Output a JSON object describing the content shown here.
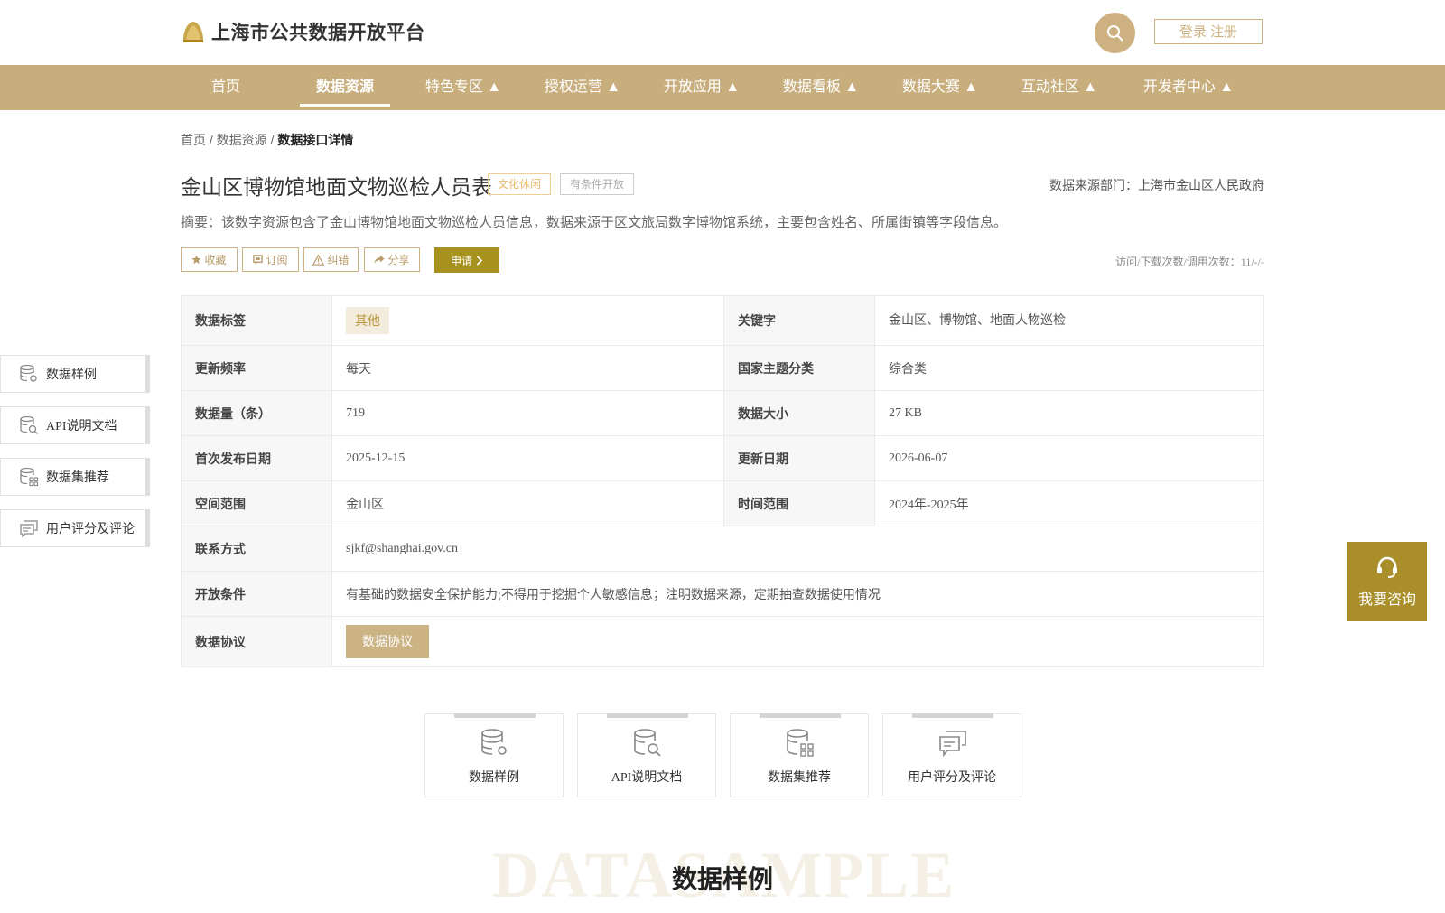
{
  "header": {
    "site_title": "上海市公共数据开放平台",
    "login_label": "登录 注册"
  },
  "nav": {
    "items": [
      {
        "label": "首页"
      },
      {
        "label": "数据资源"
      },
      {
        "label": "特色专区 ▲"
      },
      {
        "label": "授权运营 ▲"
      },
      {
        "label": "开放应用 ▲"
      },
      {
        "label": "数据看板 ▲"
      },
      {
        "label": "数据大赛 ▲"
      },
      {
        "label": "互动社区 ▲"
      },
      {
        "label": "开发者中心 ▲"
      }
    ]
  },
  "breadcrumb": {
    "home": "首页",
    "sep1": " / ",
    "resources": "数据资源",
    "sep2": " / ",
    "current": "数据接口详情"
  },
  "dataset": {
    "title": "金山区博物馆地面文物巡检人员表",
    "tag_category": "文化休闲",
    "tag_condition": "有条件开放",
    "source_dept": "数据来源部门：上海市金山区人民政府",
    "summary": "摘要：该数字资源包含了金山博物馆地面文物巡检人员信息，数据来源于区文旅局数字博物馆系统，主要包含姓名、所属街镇等字段信息。",
    "counts": "访问/下载次数/调用次数：11/-/-"
  },
  "actions": {
    "favorite": "收藏",
    "subscribe": "订阅",
    "correct": "纠错",
    "share": "分享",
    "apply": "申请"
  },
  "table": {
    "tag_label": "数据标签",
    "tag_value": "其他",
    "keyword_label": "关键字",
    "keyword_value": "金山区、博物馆、地面人物巡检",
    "freq_label": "更新频率",
    "freq_value": "每天",
    "theme_label": "国家主题分类",
    "theme_value": "综合类",
    "count_label": "数据量（条）",
    "count_value": "719",
    "size_label": "数据大小",
    "size_value": "27 KB",
    "first_pub_label": "首次发布日期",
    "first_pub_value": "2025-12-15",
    "update_label": "更新日期",
    "update_value": "2026-06-07",
    "space_label": "空间范围",
    "space_value": "金山区",
    "time_label": "时间范围",
    "time_value": "2024年-2025年",
    "contact_label": "联系方式",
    "contact_value": "sjkf@shanghai.gov.cn",
    "cond_label": "开放条件",
    "cond_value": "有基础的数据安全保护能力;不得用于挖掘个人敏感信息；注明数据来源，定期抽查数据使用情况",
    "agreement_label": "数据协议",
    "agreement_button": "数据协议"
  },
  "side_nav": {
    "items": [
      {
        "label": "数据样例",
        "icon": "database-gear-icon"
      },
      {
        "label": "API说明文档",
        "icon": "database-search-icon"
      },
      {
        "label": "数据集推荐",
        "icon": "database-grid-icon"
      },
      {
        "label": "用户评分及评论",
        "icon": "comment-icon"
      }
    ]
  },
  "consult": {
    "label": "我要咨询",
    "icon": "headset-icon"
  },
  "cards": [
    {
      "label": "数据样例",
      "icon": "database-gear-icon"
    },
    {
      "label": "API说明文档",
      "icon": "database-search-icon"
    },
    {
      "label": "数据集推荐",
      "icon": "database-grid-icon"
    },
    {
      "label": "用户评分及评论",
      "icon": "comment-icon"
    }
  ],
  "section": {
    "watermark": "DATASAMPLE",
    "title": "数据样例"
  },
  "colors": {
    "brand_gold": "#c7ae7c",
    "apply_olive": "#a8921f",
    "consult_olive": "#a98e2a"
  }
}
